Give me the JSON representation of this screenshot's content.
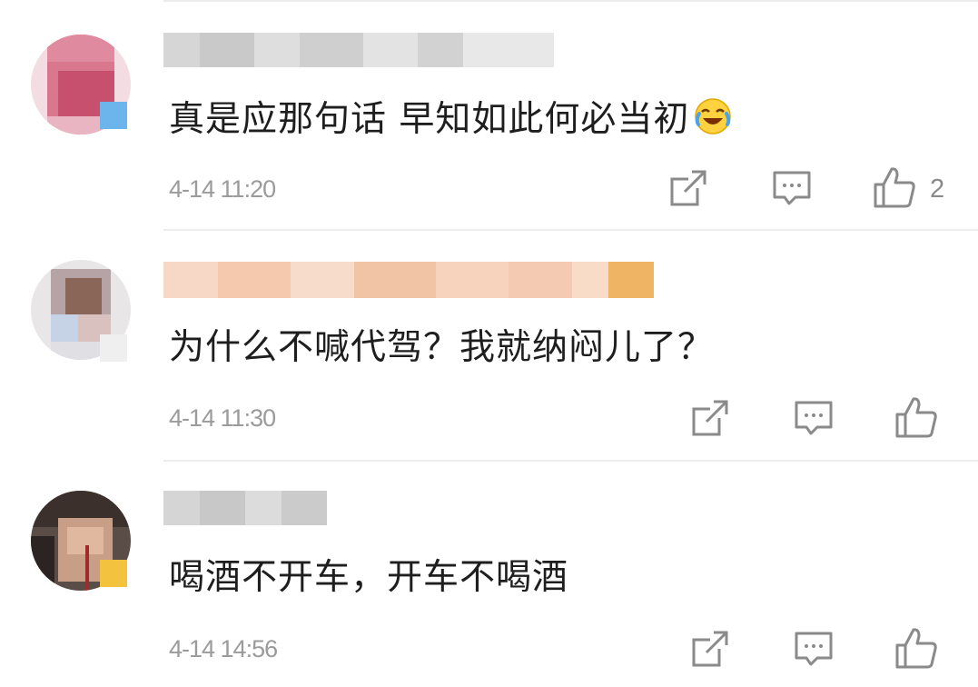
{
  "comments": [
    {
      "text": "真是应那句话 早知如此何必当初",
      "emoji": "laugh-cry-emoji",
      "time": "4-14 11:20",
      "likes": "2"
    },
    {
      "text": "为什么不喊代驾？我就纳闷儿了？",
      "time": "4-14 11:30",
      "likes": ""
    },
    {
      "text": "喝酒不开车，开车不喝酒",
      "time": "4-14 14:56",
      "likes": ""
    }
  ],
  "icons": {
    "share": "share-icon",
    "reply": "reply-icon",
    "like": "like-icon"
  },
  "colors": {
    "text": "#1e1e1e",
    "meta": "#9b9b9b",
    "icon": "#8a8a8a",
    "divider": "#ececec"
  }
}
